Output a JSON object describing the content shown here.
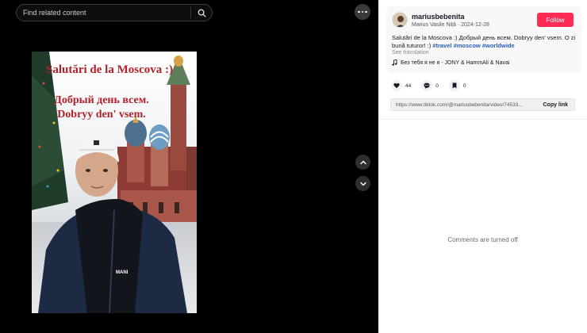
{
  "search": {
    "placeholder": "Find related content"
  },
  "video": {
    "overlay_lines": [
      "Salutări de la Moscova :)",
      "Добрый день всем.",
      "Dobryy den' vsem."
    ],
    "jacket_text": "MANI"
  },
  "post": {
    "username": "mariusbebenita",
    "display_name": "Marius Vasile Niță",
    "separator": " · ",
    "date": "2024-12-28",
    "follow_label": "Follow",
    "caption_text": "Salutări de la Moscova :) Добрый день всем. Dobryy den' vsem. O zi bună tuturor! :) ",
    "hashtags": [
      "#travel",
      "#moscow",
      "#worldwide"
    ],
    "see_translation": "See translation",
    "music": "Без тебя я не я - JONY & HammAli & Navai"
  },
  "actions": {
    "likes": "44",
    "comments": "0",
    "saves": "0"
  },
  "share": {
    "url": "https://www.tiktok.com/@mariusbebenita/video/74533...",
    "copy_label": "Copy link"
  },
  "comments": {
    "status": "Comments are turned off"
  },
  "colors": {
    "accent": "#fe2c55",
    "hashtag": "#2b5db9",
    "overlay_text": "#b3202a"
  }
}
